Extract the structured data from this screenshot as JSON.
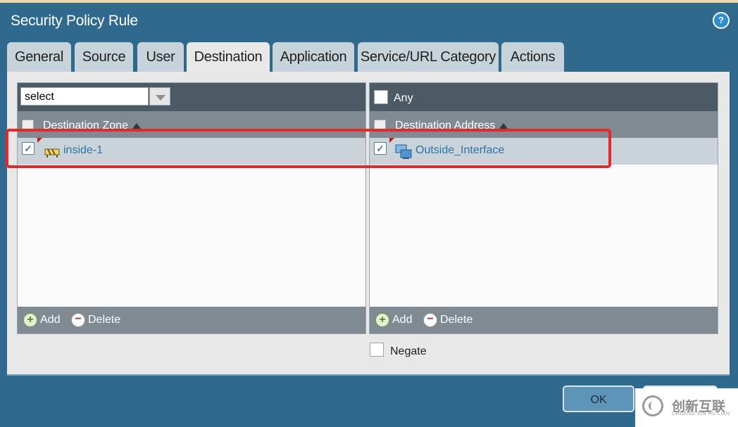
{
  "dialog": {
    "title": "Security Policy Rule",
    "help_icon": "help-icon"
  },
  "tabs": [
    {
      "label": "General",
      "active": false
    },
    {
      "label": "Source",
      "active": false
    },
    {
      "label": "User",
      "active": false
    },
    {
      "label": "Destination",
      "active": true
    },
    {
      "label": "Application",
      "active": false
    },
    {
      "label": "Service/URL Category",
      "active": false
    },
    {
      "label": "Actions",
      "active": false
    }
  ],
  "zone_panel": {
    "select_value": "select",
    "header": "Destination Zone",
    "rows": [
      {
        "checked": true,
        "icon": "zone-icon",
        "label": "inside-1"
      }
    ],
    "add_label": "Add",
    "delete_label": "Delete"
  },
  "address_panel": {
    "any_label": "Any",
    "any_checked": false,
    "header": "Destination Address",
    "rows": [
      {
        "checked": true,
        "icon": "network-interface-icon",
        "label": "Outside_Interface"
      }
    ],
    "add_label": "Add",
    "delete_label": "Delete"
  },
  "negate": {
    "label": "Negate",
    "checked": false
  },
  "buttons": {
    "ok_label": "OK"
  },
  "watermark": {
    "text": "创新互联",
    "sub": "CHUANG XIN HU LIAN"
  },
  "colors": {
    "dialog_bg": "#2f6a8e",
    "highlight_border": "#e8272a",
    "link_text": "#2b76a9"
  }
}
